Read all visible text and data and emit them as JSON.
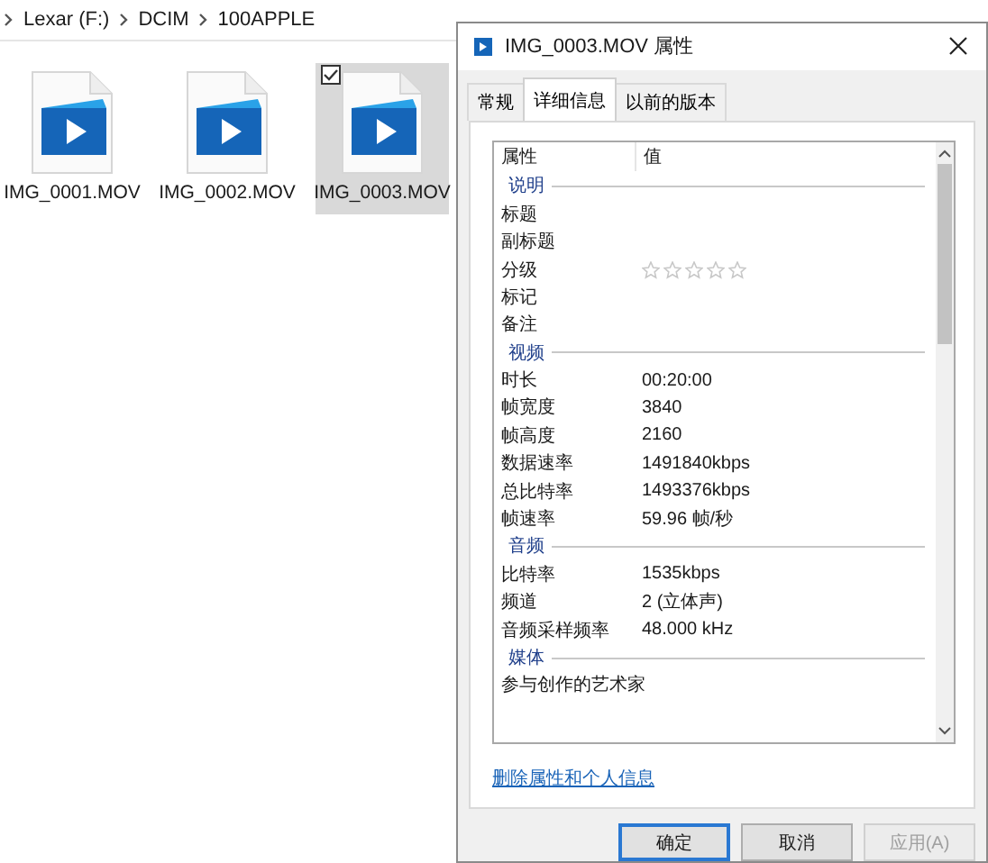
{
  "explorer": {
    "breadcrumb": [
      "Lexar (F:)",
      "DCIM",
      "100APPLE"
    ],
    "files": [
      {
        "name": "IMG_0001.MOV",
        "selected": false
      },
      {
        "name": "IMG_0002.MOV",
        "selected": false
      },
      {
        "name": "IMG_0003.MOV",
        "selected": true
      }
    ]
  },
  "dialog": {
    "title": "IMG_0003.MOV 属性",
    "tabs": [
      {
        "label": "常规",
        "selected": false
      },
      {
        "label": "详细信息",
        "selected": true
      },
      {
        "label": "以前的版本",
        "selected": false
      }
    ],
    "columns": [
      "属性",
      "值"
    ],
    "sections": [
      {
        "heading": "说明",
        "rows": [
          {
            "name": "标题",
            "value": ""
          },
          {
            "name": "副标题",
            "value": ""
          },
          {
            "name": "分级",
            "kind": "stars",
            "stars": 0
          },
          {
            "name": "标记",
            "value": ""
          },
          {
            "name": "备注",
            "value": ""
          }
        ]
      },
      {
        "heading": "视频",
        "rows": [
          {
            "name": "时长",
            "value": "00:20:00"
          },
          {
            "name": "帧宽度",
            "value": "3840"
          },
          {
            "name": "帧高度",
            "value": "2160"
          },
          {
            "name": "数据速率",
            "value": "1491840kbps"
          },
          {
            "name": "总比特率",
            "value": "1493376kbps"
          },
          {
            "name": "帧速率",
            "value": "59.96 帧/秒"
          }
        ]
      },
      {
        "heading": "音频",
        "rows": [
          {
            "name": "比特率",
            "value": "1535kbps"
          },
          {
            "name": "频道",
            "value": "2 (立体声)"
          },
          {
            "name": "音频采样频率",
            "value": "48.000 kHz"
          }
        ]
      },
      {
        "heading": "媒体",
        "rows": [
          {
            "name": "参与创作的艺术家",
            "value": ""
          }
        ]
      }
    ],
    "link": "删除属性和个人信息",
    "buttons": [
      {
        "label": "确定",
        "default": true,
        "disabled": false
      },
      {
        "label": "取消",
        "default": false,
        "disabled": false
      },
      {
        "label": "应用(A)",
        "default": false,
        "disabled": true
      }
    ]
  }
}
